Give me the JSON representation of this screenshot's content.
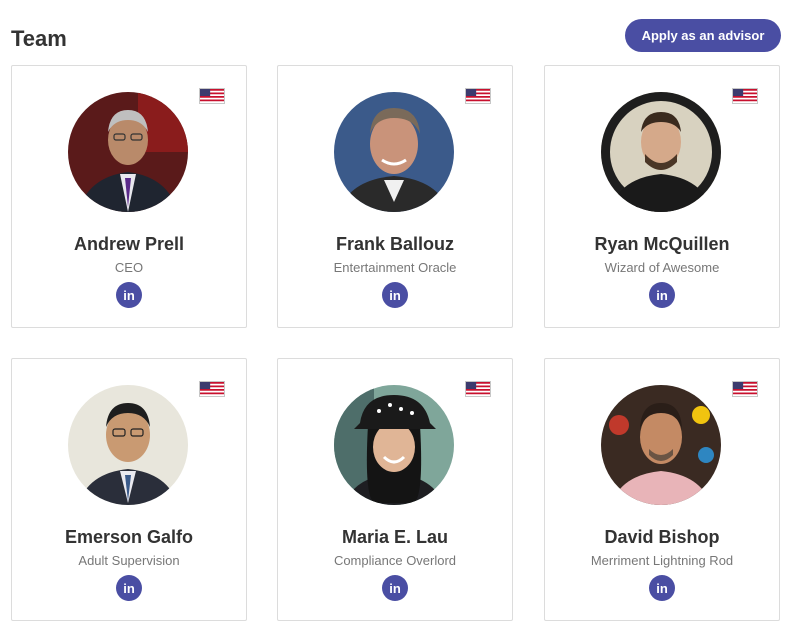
{
  "header": {
    "title": "Team",
    "apply_label": "Apply as an advisor"
  },
  "team": [
    {
      "name": "Andrew Prell",
      "role": "CEO",
      "flag": "us-flag-icon",
      "linkedin": "in"
    },
    {
      "name": "Frank Ballouz",
      "role": "Entertainment Oracle",
      "flag": "us-flag-icon",
      "linkedin": "in"
    },
    {
      "name": "Ryan McQuillen",
      "role": "Wizard of Awesome",
      "flag": "us-flag-icon",
      "linkedin": "in"
    },
    {
      "name": "Emerson Galfo",
      "role": "Adult Supervision",
      "flag": "us-flag-icon",
      "linkedin": "in"
    },
    {
      "name": "Maria E. Lau",
      "role": "Compliance Overlord",
      "flag": "us-flag-icon",
      "linkedin": "in"
    },
    {
      "name": "David Bishop",
      "role": "Merriment Lightning Rod",
      "flag": "us-flag-icon",
      "linkedin": "in"
    }
  ],
  "colors": {
    "accent": "#4a4ea3",
    "text": "#333333",
    "subtext": "#777777",
    "border": "#dcdcdc"
  }
}
